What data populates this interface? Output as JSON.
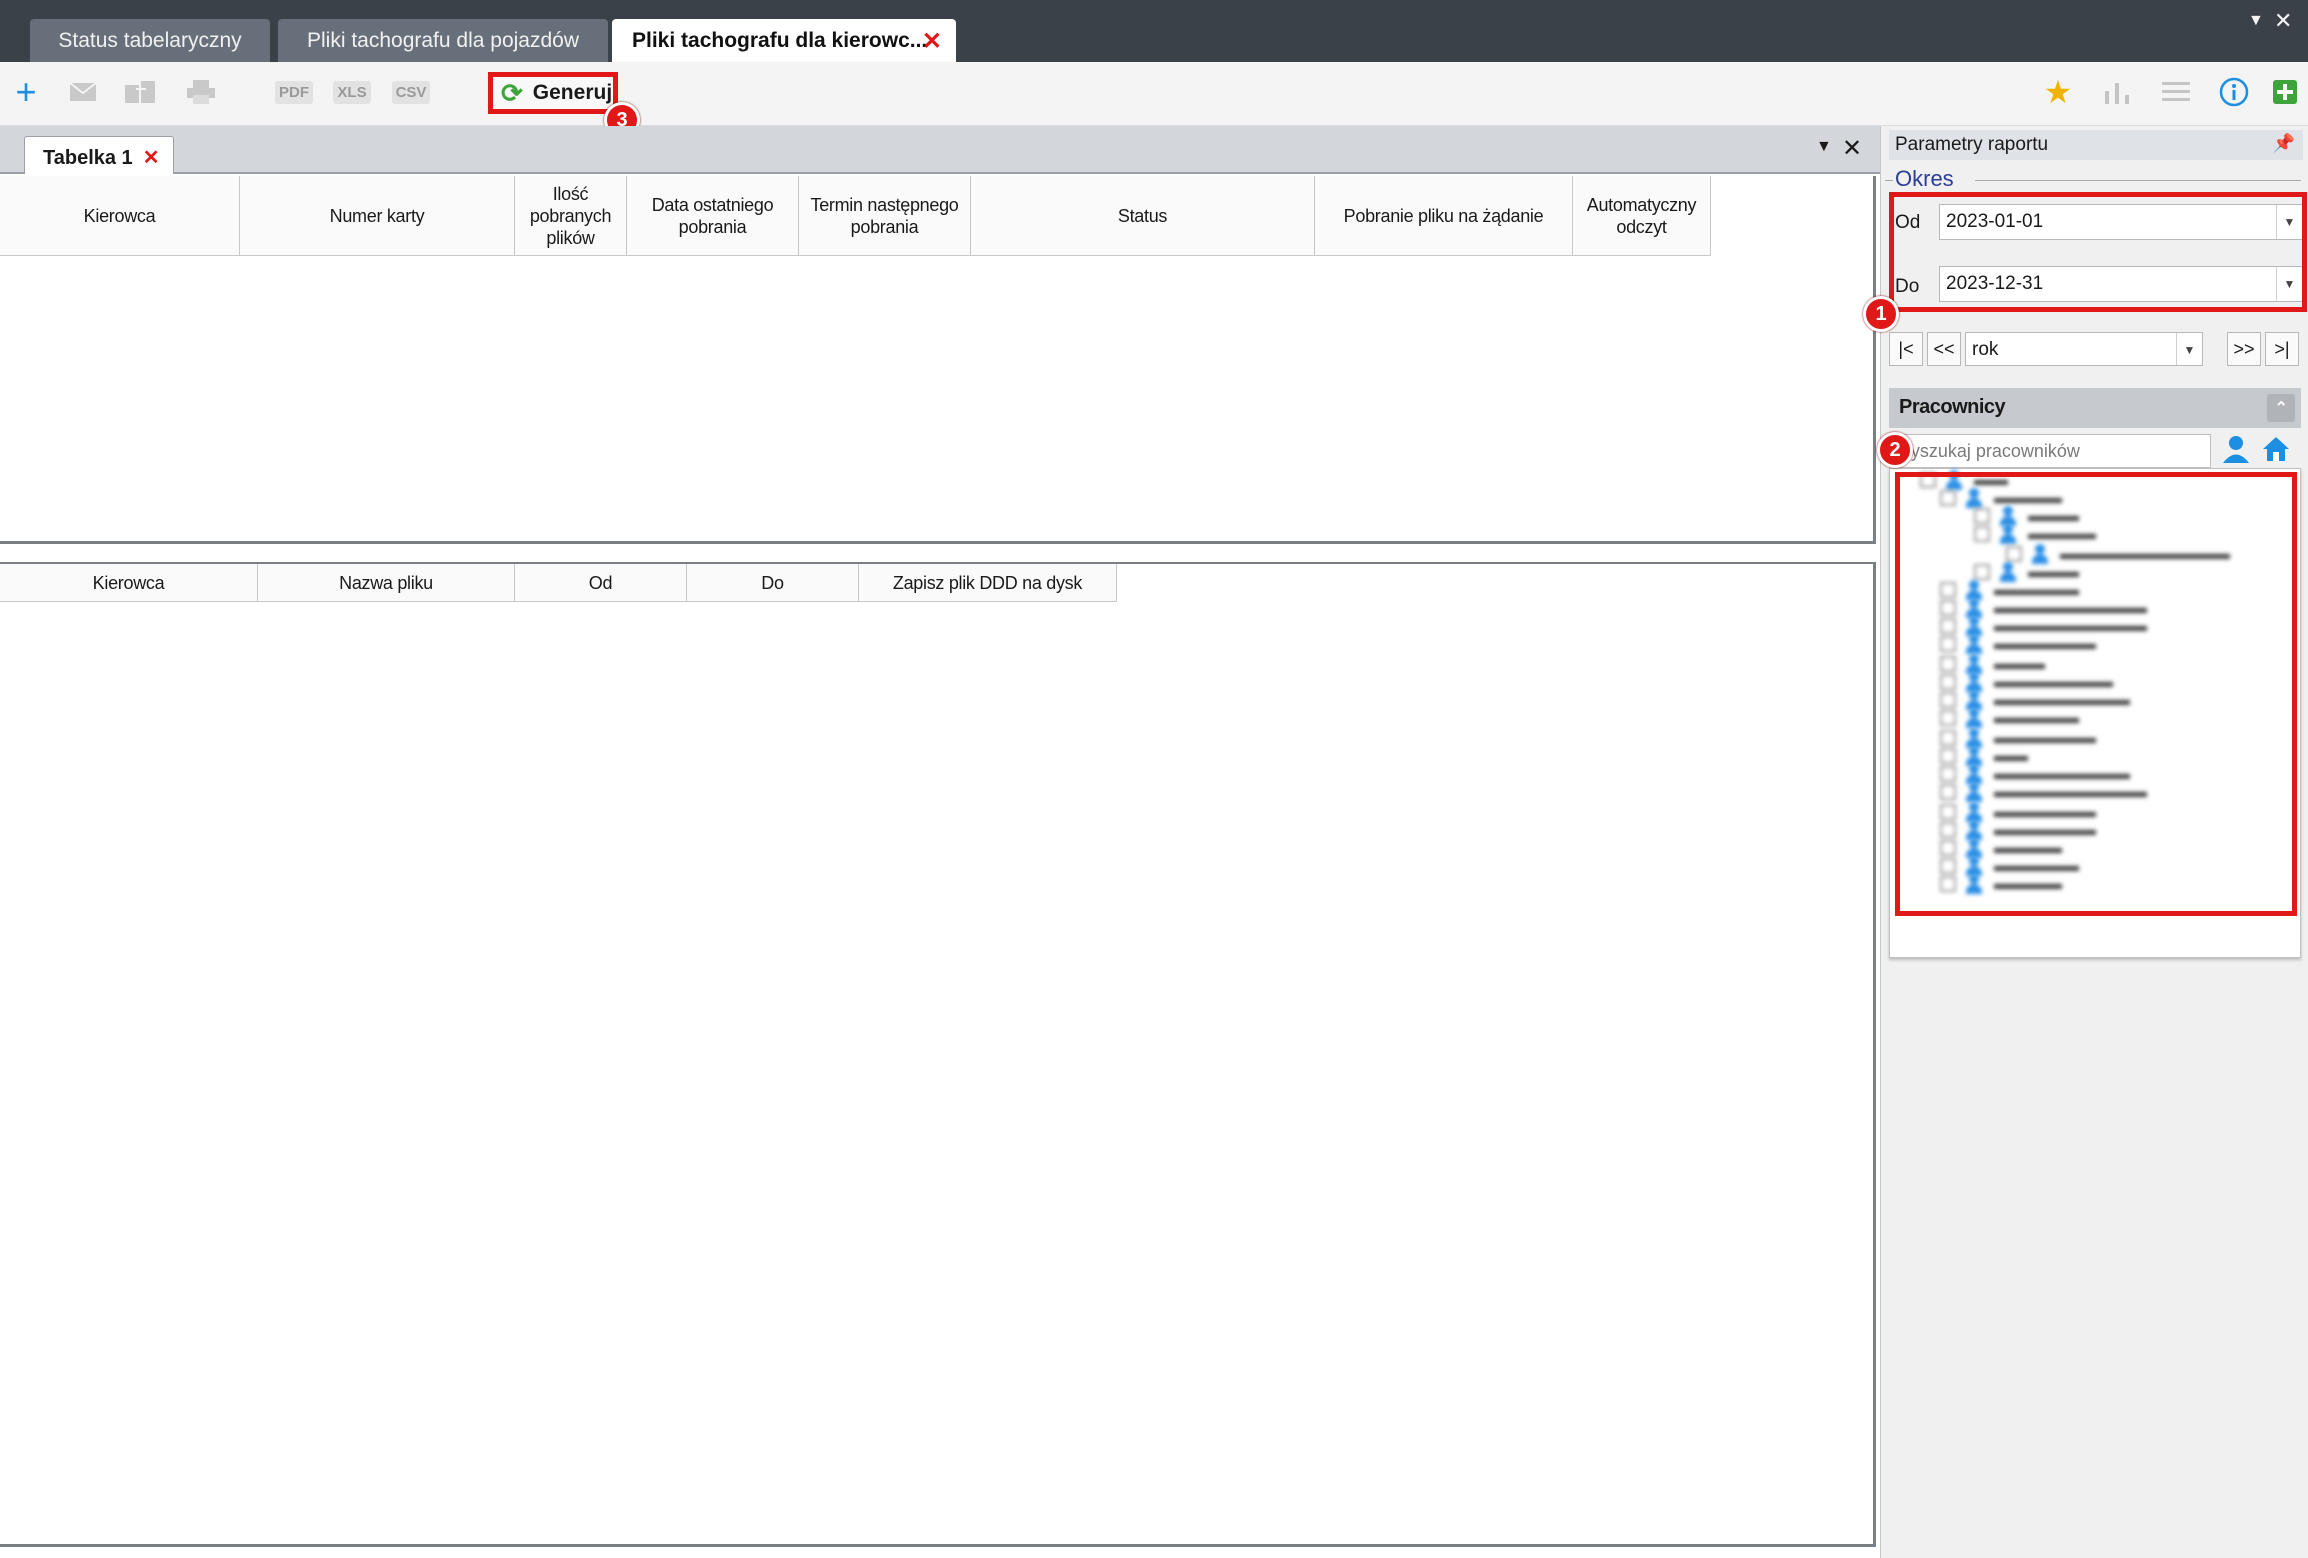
{
  "tabs": [
    {
      "label": "Status tabelaryczny",
      "active": false
    },
    {
      "label": "Pliki tachografu dla pojazdów",
      "active": false
    },
    {
      "label": "Pliki tachografu dla kierowc...",
      "active": true
    }
  ],
  "toolbar": {
    "pdf_label": "PDF",
    "xls_label": "XLS",
    "csv_label": "CSV",
    "generate_label": "Generuj",
    "generate_badge": "3"
  },
  "subtab": {
    "label": "Tabelka 1"
  },
  "table1": {
    "headers": [
      "Kierowca",
      "Numer karty",
      "Ilość pobranych plików",
      "Data ostatniego pobrania",
      "Termin następnego pobrania",
      "Status",
      "Pobranie pliku na żądanie",
      "Automatyczny odczyt"
    ],
    "rows": []
  },
  "table2": {
    "headers": [
      "Kierowca",
      "Nazwa pliku",
      "Od",
      "Do",
      "Zapisz plik DDD na dysk"
    ],
    "rows": []
  },
  "panel": {
    "title": "Parametry raportu",
    "okres_label": "Okres",
    "od_label": "Od",
    "od_value": "2023-01-01",
    "do_label": "Do",
    "do_value": "2023-12-31",
    "badge1": "1",
    "nav_first": "|<",
    "nav_prev": "<<",
    "nav_next": ">>",
    "nav_last": ">|",
    "period_value": "rok",
    "employees_header": "Pracownicy",
    "search_placeholder": "Wyszukaj pracowników",
    "badge2": "2"
  },
  "colors": {
    "accent_red": "#e01818",
    "tab_strip": "#3b4148",
    "generate_green": "#3da33a",
    "icon_blue": "#1c8fe3"
  }
}
